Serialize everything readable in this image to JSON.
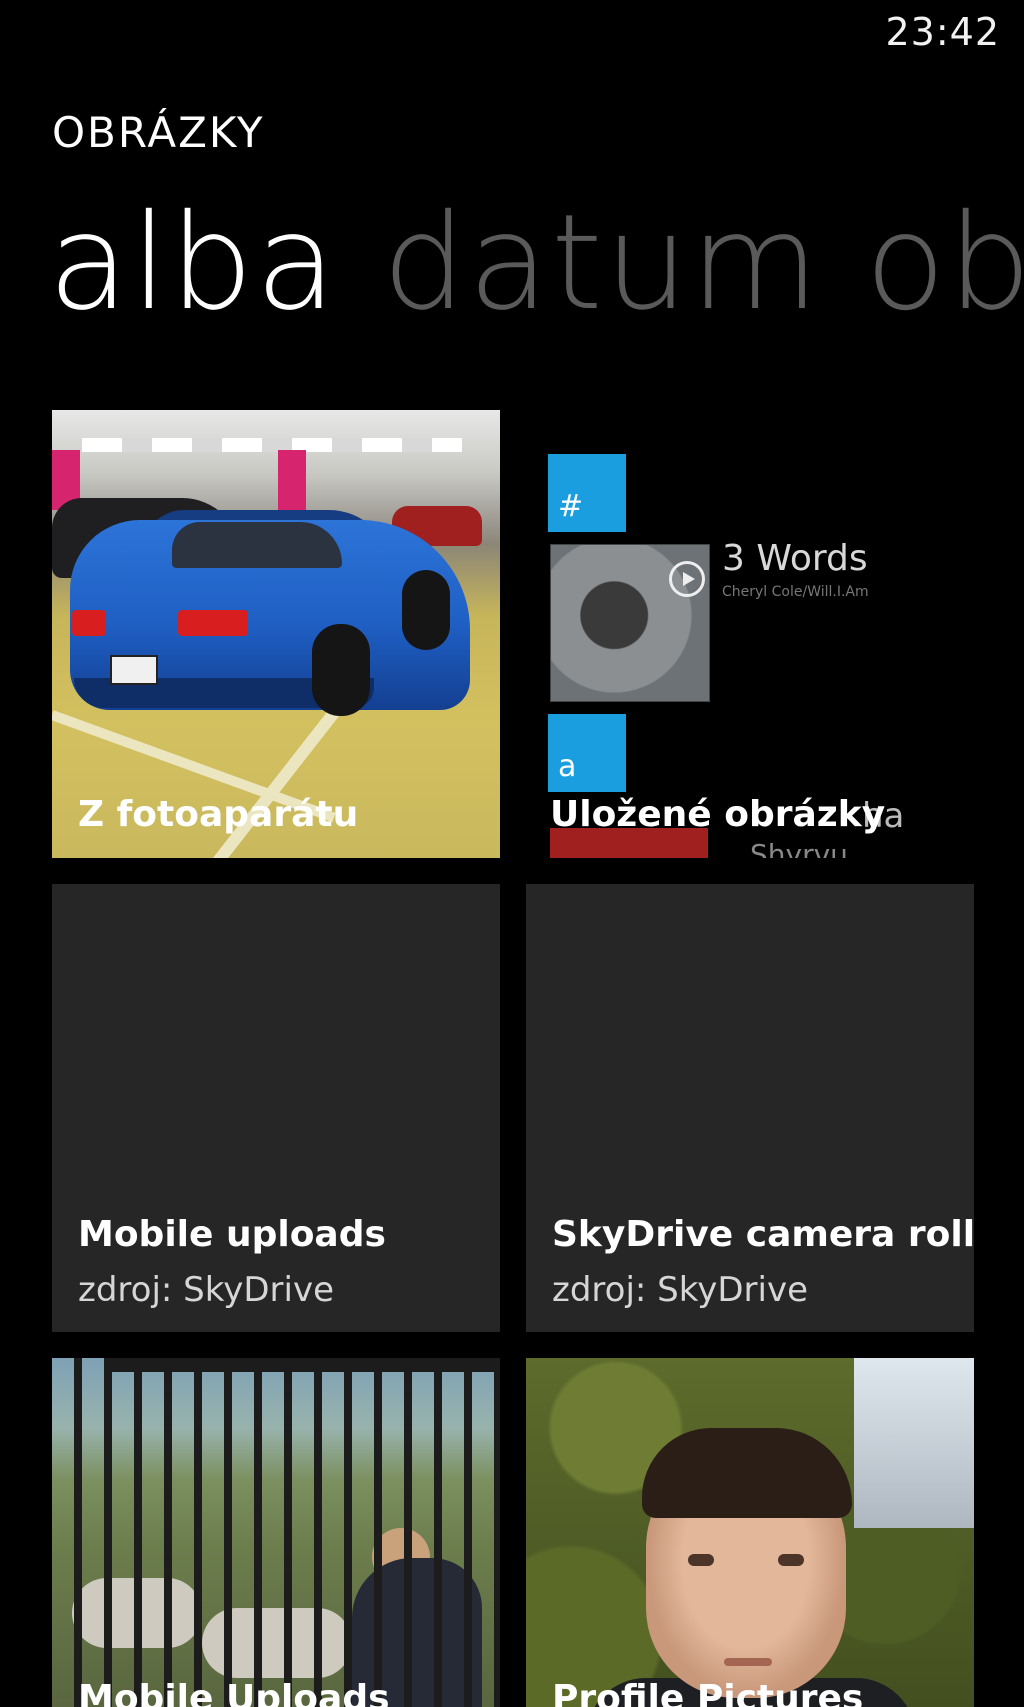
{
  "status_bar": {
    "time": "23:42"
  },
  "app": {
    "title": "OBRÁZKY"
  },
  "pivot": {
    "items": [
      {
        "label": "alba",
        "active": true
      },
      {
        "label": "datum",
        "active": false
      },
      {
        "label": "ob",
        "active": false
      }
    ]
  },
  "albums": [
    {
      "name": "Z fotoaparátu"
    },
    {
      "name": "Uložené obrázky",
      "preview": {
        "jump_letters": [
          "#",
          "a"
        ],
        "song_title": "3 Words",
        "song_artist": "Cheryl Cole/Will.I.Am",
        "peek_text": "ha",
        "peek_sub": "Shyrvu"
      }
    },
    {
      "name": "Mobile uploads",
      "source": "zdroj: SkyDrive"
    },
    {
      "name": "SkyDrive camera roll",
      "source": "zdroj: SkyDrive"
    },
    {
      "name": "Mobile Uploads"
    },
    {
      "name": "Profile Pictures"
    }
  ],
  "colors": {
    "background": "#000000",
    "accent": "#1a9ee0",
    "tile_dark": "#262626",
    "pivot_inactive": "#5a5a5a"
  }
}
